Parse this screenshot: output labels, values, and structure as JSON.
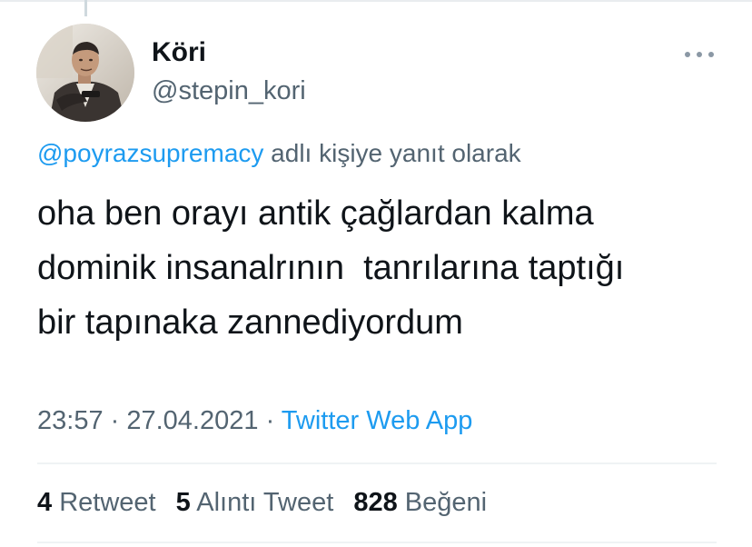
{
  "author": {
    "display_name": "Köri",
    "handle": "@stepin_kori",
    "avatar_icon": "profile-photo"
  },
  "more_icon": "more-horizontal-icon",
  "reply_context": {
    "mention": "@poyrazsupremacy",
    "suffix": " adlı kişiye yanıt olarak"
  },
  "tweet": {
    "text": "oha ben orayı antik çağlardan kalma\ndominik insanalrının  tanrılarına taptığı\nbir tapınaka zannediyordum"
  },
  "meta": {
    "time": "23:57",
    "separator": " · ",
    "date": "27.04.2021",
    "source": "Twitter Web App"
  },
  "stats": {
    "retweets_count": "4",
    "retweets_label": "Retweet",
    "quotes_count": "5",
    "quotes_label": "Alıntı Tweet",
    "likes_count": "828",
    "likes_label": "Beğeni"
  },
  "colors": {
    "link": "#1d9bf0",
    "secondary_text": "#536471",
    "primary_text": "#0f1419"
  }
}
